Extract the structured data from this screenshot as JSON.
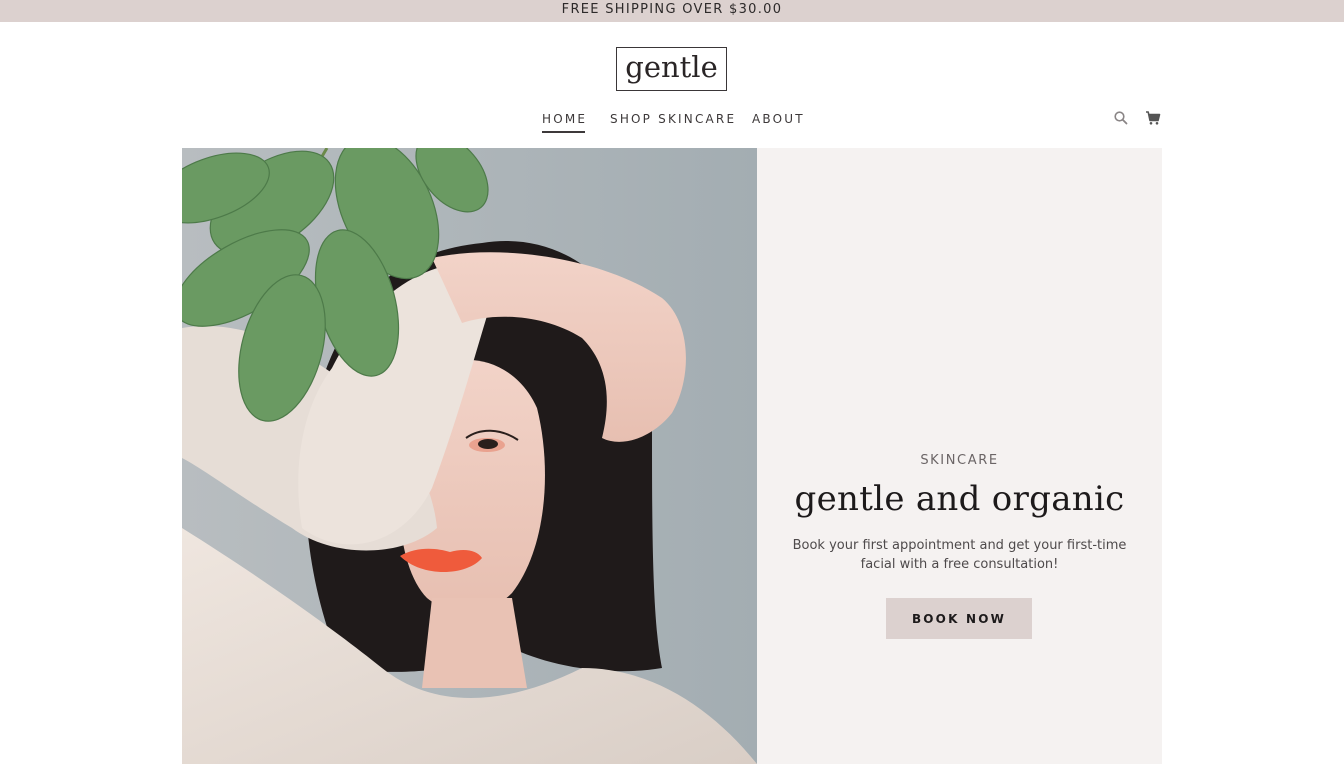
{
  "announcement": {
    "text": "FREE SHIPPING OVER $30.00"
  },
  "brand": {
    "logo_text": "gentle"
  },
  "nav": {
    "items": [
      {
        "label": "HOME",
        "active": true
      },
      {
        "label": "SHOP SKINCARE",
        "active": false
      },
      {
        "label": "ABOUT",
        "active": false
      }
    ]
  },
  "header_icons": {
    "search": "search-icon",
    "cart": "cart-icon"
  },
  "hero": {
    "image": "woman-with-leaves-photo",
    "eyebrow": "SKINCARE",
    "headline": "gentle and organic",
    "subtext": "Book your first appointment and get your first-time facial with a free consultation!",
    "cta_label": "BOOK NOW"
  },
  "colors": {
    "announcement_bg": "#dcd1cf",
    "panel_bg": "#f5f2f1",
    "button_bg": "#dcd1cf",
    "text_dark": "#1d1a1b"
  }
}
